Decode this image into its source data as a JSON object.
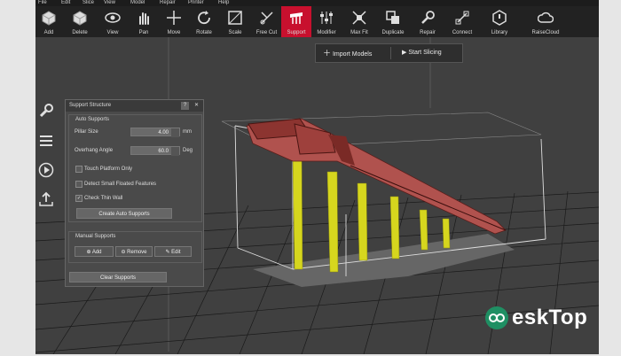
{
  "menu": [
    "File",
    "Edit",
    "Slice",
    "View",
    "Model",
    "Repair",
    "Printer",
    "Help"
  ],
  "toolbar": [
    {
      "label": "Add",
      "icon": "add-cube-icon"
    },
    {
      "label": "Delete",
      "icon": "delete-cube-icon"
    },
    {
      "label": "View",
      "icon": "eye-icon"
    },
    {
      "label": "Pan",
      "icon": "hand-icon"
    },
    {
      "label": "Move",
      "icon": "move-arrows-icon"
    },
    {
      "label": "Rotate",
      "icon": "rotate-icon"
    },
    {
      "label": "Scale",
      "icon": "scale-icon"
    },
    {
      "label": "Free Cut",
      "icon": "free-cut-icon"
    },
    {
      "label": "Support",
      "icon": "support-icon",
      "active": true
    },
    {
      "label": "Modifier",
      "icon": "modifier-sliders-icon"
    },
    {
      "label": "Max Fit",
      "icon": "max-fit-icon"
    },
    {
      "label": "Duplicate",
      "icon": "duplicate-icon"
    },
    {
      "label": "Repair",
      "icon": "wrench-icon"
    },
    {
      "label": "Connect",
      "icon": "connect-icon"
    },
    {
      "label": "Library",
      "icon": "library-icon"
    },
    {
      "label": "RaiseCloud",
      "icon": "cloud-icon"
    }
  ],
  "actions": {
    "import_models": "Import Models",
    "start_slicing": "Start Slicing"
  },
  "panel": {
    "title": "Support Structure",
    "help": "?",
    "close": "✕",
    "auto_supports": "Auto Supports",
    "pillar_size_label": "Pillar Size",
    "pillar_size_value": "4.00",
    "pillar_size_unit": "mm",
    "overhang_label": "Overhang Angle",
    "overhang_value": "60.0",
    "overhang_unit": "Deg",
    "touch_platform": "Touch Platform Only",
    "touch_platform_checked": false,
    "detect_small": "Detect Small Floated Features",
    "detect_small_checked": false,
    "check_thin": "Check Thin Wall",
    "check_thin_checked": true,
    "create_auto": "Create Auto Supports",
    "manual_supports": "Manual Supports",
    "add": "Add",
    "remove": "Remove",
    "edit": "Edit",
    "clear": "Clear Supports"
  },
  "watermark": {
    "text": "eskTop",
    "brand_color": "#1f8f63"
  },
  "colors": {
    "accent": "#c8102e",
    "support": "#d6d61e",
    "model": "#b0524e"
  }
}
